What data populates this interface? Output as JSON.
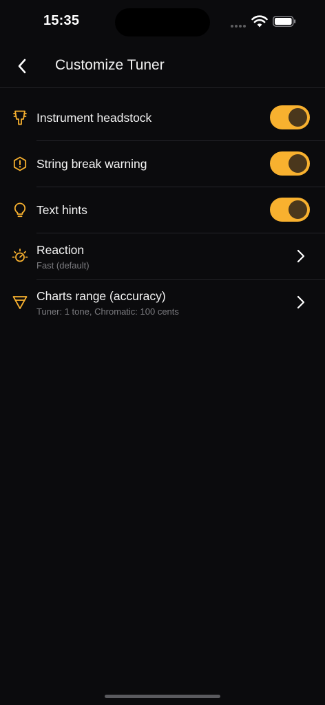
{
  "status_bar": {
    "time": "15:35",
    "icons": [
      "signal-dots-icon",
      "wifi-icon",
      "battery-icon"
    ]
  },
  "header": {
    "title": "Customize Tuner",
    "back_icon": "chevron-left-icon"
  },
  "settings": [
    {
      "label": "Instrument headstock",
      "icon": "headstock-icon",
      "control": "toggle",
      "on": true
    },
    {
      "label": "String break warning",
      "icon": "warning-hexagon-icon",
      "control": "toggle",
      "on": true
    },
    {
      "label": "Text hints",
      "icon": "lightbulb-icon",
      "control": "toggle",
      "on": true
    },
    {
      "label": "Reaction",
      "sublabel": "Fast (default)",
      "icon": "speedometer-icon",
      "control": "chevron"
    },
    {
      "label": "Charts range (accuracy)",
      "sublabel": "Tuner: 1 tone, Chromatic: 100 cents",
      "icon": "funnel-triangle-icon",
      "control": "chevron"
    }
  ],
  "colors": {
    "accent": "#f8b12f",
    "background": "#0b0b0d",
    "knob": "#4a371c",
    "divider": "#26262a",
    "subtext": "#7c7c80"
  }
}
